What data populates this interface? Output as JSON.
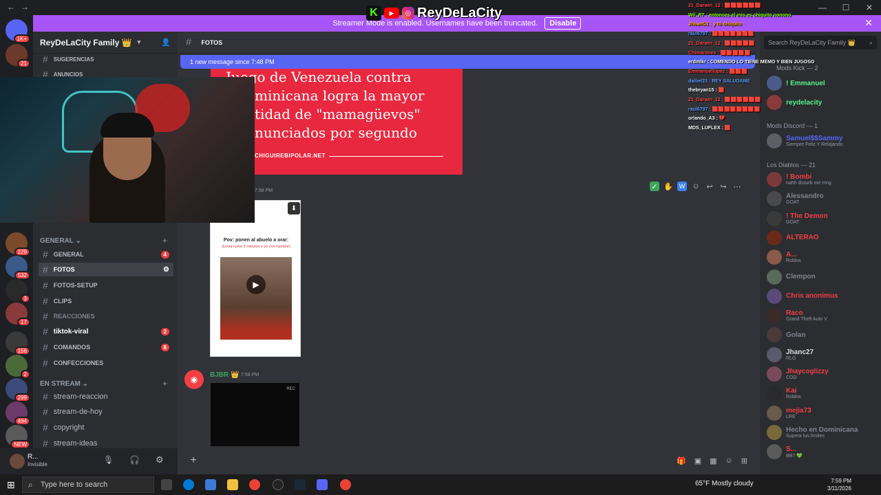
{
  "window": {
    "nav_back": "←",
    "nav_forward": "→",
    "title": "Discord",
    "controls": [
      "—",
      "☐",
      "✕"
    ]
  },
  "banner": {
    "text": "Streamer Mode is enabled. Usernames have been truncated.",
    "button": "Disable",
    "close": "✕"
  },
  "overlay": {
    "kick": "K",
    "youtube": "▶",
    "instagram": "◎",
    "name": "ReyDeLaCity"
  },
  "server": {
    "name": "ReyDeLaCity Family 👑",
    "header_icon": "chevron-down"
  },
  "sidebar": {
    "top_channels": [
      {
        "label": "SUGERENCIAS"
      },
      {
        "label": "ANUNCIOS"
      }
    ],
    "category_general": "GENERAL",
    "channels": [
      {
        "label": "GENERAL",
        "badge": "4"
      },
      {
        "label": "FOTOS",
        "badge": ""
      },
      {
        "label": "FOTOS-SETUP",
        "badge": ""
      },
      {
        "label": "CLIPS",
        "badge": ""
      },
      {
        "label": "REACCIONES",
        "badge": ""
      },
      {
        "label": "tiktok-viral",
        "badge": "2"
      },
      {
        "label": "COMANDOS",
        "badge": "8"
      },
      {
        "label": "CONFECCIONES",
        "badge": ""
      }
    ],
    "category_stream": "EN STREAM",
    "stream_channels": [
      {
        "label": "stream-reaccion"
      },
      {
        "label": "stream-de-hoy"
      },
      {
        "label": "copyright"
      },
      {
        "label": "stream-ideas"
      }
    ]
  },
  "server_badges": [
    "1K+",
    "21",
    "229",
    "532",
    "3",
    "17",
    "156",
    "2",
    "299",
    "494",
    "NEW"
  ],
  "user": {
    "name": "R...",
    "status": "Invisible"
  },
  "chat": {
    "channel": "FOTOS",
    "new_messages": "1 new message since 7:48 PM",
    "meme_lines": [
      "Juego de Venezuela contra",
      "minicana logra la mayor",
      "tidad de \"mamagüevos\"",
      "nunciados por segundo"
    ],
    "meme_source": "CHIGUIREBIPOLAR.NET",
    "msg1_time": "7:58 PM",
    "video_caption": "Pov: ponen al abuelo a orar:",
    "video_sub": "(Llevá como 5 minutos y yo con hambre)",
    "author2": "BJBR 👑",
    "msg2_time": "7:58 PM",
    "video2_label": "REC"
  },
  "members": {
    "search": "Search ReyDeLaCity Family 👑",
    "cat_kick": "Mods Kick — 2",
    "kick": [
      {
        "name": "! Emmanuel",
        "color": "#57f287"
      },
      {
        "name": "reydelacity",
        "color": "#57f287"
      }
    ],
    "cat_discord": "Mods Discord — 1",
    "discord": [
      {
        "name": "Samuel$$Sammy",
        "status": "Siempre Feliz Y Relajando",
        "color": "#5865f2"
      }
    ],
    "cat_diablos": "Los Diablos — 21",
    "diablos": [
      {
        "name": "! Bombi",
        "status": "nahh disturb me mng",
        "color": "#f23f43"
      },
      {
        "name": "Alessandro",
        "status": "GOAT",
        "color": "#80848e"
      },
      {
        "name": "! The Demon",
        "status": "GOAT",
        "color": "#f23f43"
      },
      {
        "name": "ALTERAO",
        "status": "",
        "color": "#f23f43"
      },
      {
        "name": "A...",
        "status": "Roblox",
        "color": "#f23f43"
      },
      {
        "name": "Clempon",
        "status": "",
        "color": "#80848e"
      },
      {
        "name": "Chris anonimus",
        "status": "",
        "color": "#f23f43"
      },
      {
        "name": "Raco",
        "status": "Grand Theft Auto V",
        "color": "#f23f43"
      },
      {
        "name": "Golan",
        "status": "",
        "color": "#80848e"
      },
      {
        "name": "Jhanc27",
        "status": "RLG",
        "color": "#dbdee1"
      },
      {
        "name": "Jhaycoglizzy",
        "status": "COD",
        "color": "#f23f43"
      },
      {
        "name": "Kai",
        "status": "Roblox",
        "color": "#f23f43"
      },
      {
        "name": "mejia73",
        "status": "LRE",
        "color": "#f23f43"
      },
      {
        "name": "Hecho en Dominicana",
        "status": "Supera tus límites",
        "color": "#80848e"
      },
      {
        "name": "S...",
        "status": "BB7 💚",
        "color": "#f23f43"
      }
    ]
  },
  "twitch_chat": [
    {
      "text": "21_Darwin_12 : 🟥🟥🟥🟥🟥🟥",
      "color": "#ff4040"
    },
    {
      "text": "Wil_RT : entonces el mio es chiquito nonono",
      "color": "#7cfc00"
    },
    {
      "text": "JhoanG1 : y tú chiquito",
      "color": "#ffa500"
    },
    {
      "text": "raul6797 : 🟥🟥🟥🟥🟥🟥🟥",
      "color": "#5a9cff"
    },
    {
      "text": "21_Darwin_12 : 🟥🟥🟥🟥🟥",
      "color": "#ff4040"
    },
    {
      "text": "Chimarones : 🟥🟥🟥🟥🟥",
      "color": "#ff4040"
    },
    {
      "text": "erdmlkr : COMENDO LO TIENE MEMO Y BIEN JUGOSO",
      "color": "#ffffff"
    },
    {
      "text": "Emmanuellopez : 🟥🟥🟥",
      "color": "#ff4040"
    },
    {
      "text": "daibel23 : REY SALUDAME",
      "color": "#5a9cff"
    },
    {
      "text": "thebryan15 : 🟥",
      "color": "#ffffff"
    },
    {
      "text": "21_Darwin_12 : 🟥🟥🟥🟥🟥🟥",
      "color": "#ff4040"
    },
    {
      "text": "raul6797 : 🟥🟥🟥🟥🟥🟥🟥🟥",
      "color": "#5a9cff"
    },
    {
      "text": "orlando_A3 : 💔",
      "color": "#ffffff"
    },
    {
      "text": "MDS_LUFLEX : 🟥",
      "color": "#ffffff"
    }
  ],
  "taskbar": {
    "search": "Type here to search",
    "weather": "65°F  Mostly cloudy",
    "time": "7:59 PM",
    "date": "3/11/2026"
  }
}
